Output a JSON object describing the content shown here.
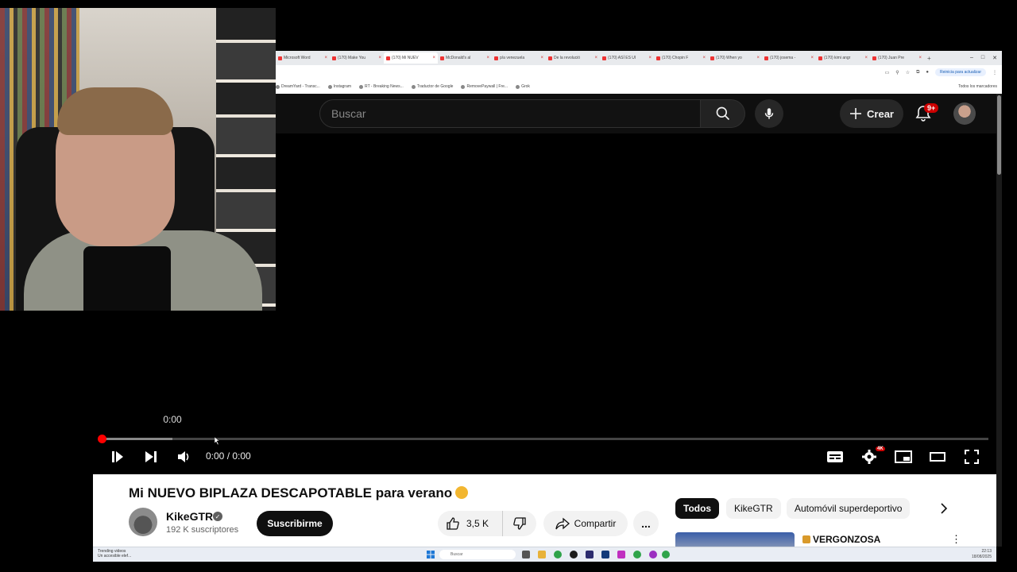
{
  "browser": {
    "tabs": [
      {
        "label": "Microsoft Word",
        "active": false
      },
      {
        "label": "(170) Make You",
        "active": false
      },
      {
        "label": "(170) Mi NUEV",
        "active": true
      },
      {
        "label": "McDonald's al",
        "active": false
      },
      {
        "label": "p/a venezuela",
        "active": false
      },
      {
        "label": "De la revolució",
        "active": false
      },
      {
        "label": "(170) ASÍ ES UI",
        "active": false
      },
      {
        "label": "(170) Chopin F",
        "active": false
      },
      {
        "label": "(170) When yo",
        "active": false
      },
      {
        "label": "(170) josema -",
        "active": false
      },
      {
        "label": "(170) kimi angr",
        "active": false
      },
      {
        "label": "(170) Juan Pre",
        "active": false
      }
    ],
    "new_tab": "+",
    "update_pill": "Reinicia para actualizar",
    "bookmarks": [
      "DreamYard - Transc...",
      "Instagram",
      "RT - Breaking News...",
      "Traductor de Google",
      "RemovePaywall | Fre...",
      "Grok"
    ],
    "all_bookmarks": "Todos los marcadores"
  },
  "header": {
    "search_placeholder": "Buscar",
    "create_label": "Crear",
    "notifications_badge": "9+"
  },
  "player": {
    "tooltip_time": "0:00",
    "timecode": "0:00 / 0:00",
    "quality_badge": "4K",
    "progress_fraction": 0.0,
    "buffer_fraction": 0.08
  },
  "video": {
    "title": "Mi NUEVO BIPLAZA DESCAPOTABLE para verano",
    "channel_name": "KikeGTR",
    "subscribers": "192 K suscriptores",
    "subscribe_label": "Suscribirme",
    "likes": "3,5 K",
    "share_label": "Compartir",
    "more_label": "..."
  },
  "chips": [
    {
      "label": "Todos",
      "active": true
    },
    {
      "label": "KikeGTR",
      "active": false
    },
    {
      "label": "Automóvil superdeportivo",
      "active": false
    }
  ],
  "recommendation": {
    "title": "VERGONZOSA"
  },
  "taskbar": {
    "notification_title": "Trending videos",
    "notification_sub": "Un accesible elef...",
    "search_placeholder": "Buscar",
    "clock_time": "22:13",
    "clock_date": "18/08/2025"
  },
  "colors": {
    "youtube_red": "#ff0000",
    "page_dark": "#0f0f0f",
    "badge_red": "#cc0000"
  }
}
